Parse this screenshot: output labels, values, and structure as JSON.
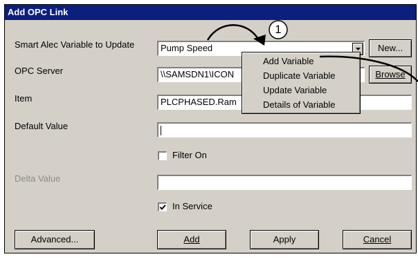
{
  "window": {
    "title": "Add OPC Link"
  },
  "labels": {
    "variable": "Smart Alec Variable to Update",
    "opc_server": "OPC Server",
    "item": "Item",
    "default_value": "Default Value",
    "delta_value": "Delta Value"
  },
  "fields": {
    "variable_value": "Pump Speed",
    "opc_server_value": "\\\\SAMSDN1\\ICON",
    "item_value": "PLCPHASED.Ram",
    "default_value": "",
    "delta_value": ""
  },
  "buttons": {
    "new": "New...",
    "browse": "Browse",
    "advanced": "Advanced...",
    "add": "Add",
    "apply": "Apply",
    "cancel": "Cancel"
  },
  "checkboxes": {
    "filter_on": {
      "label": "Filter On",
      "checked": false
    },
    "in_service": {
      "label": "In Service",
      "checked": true
    }
  },
  "context_menu": {
    "items": [
      "Add Variable",
      "Duplicate Variable",
      "Update Variable",
      "Details of Variable"
    ]
  },
  "callout": {
    "number": "1"
  }
}
